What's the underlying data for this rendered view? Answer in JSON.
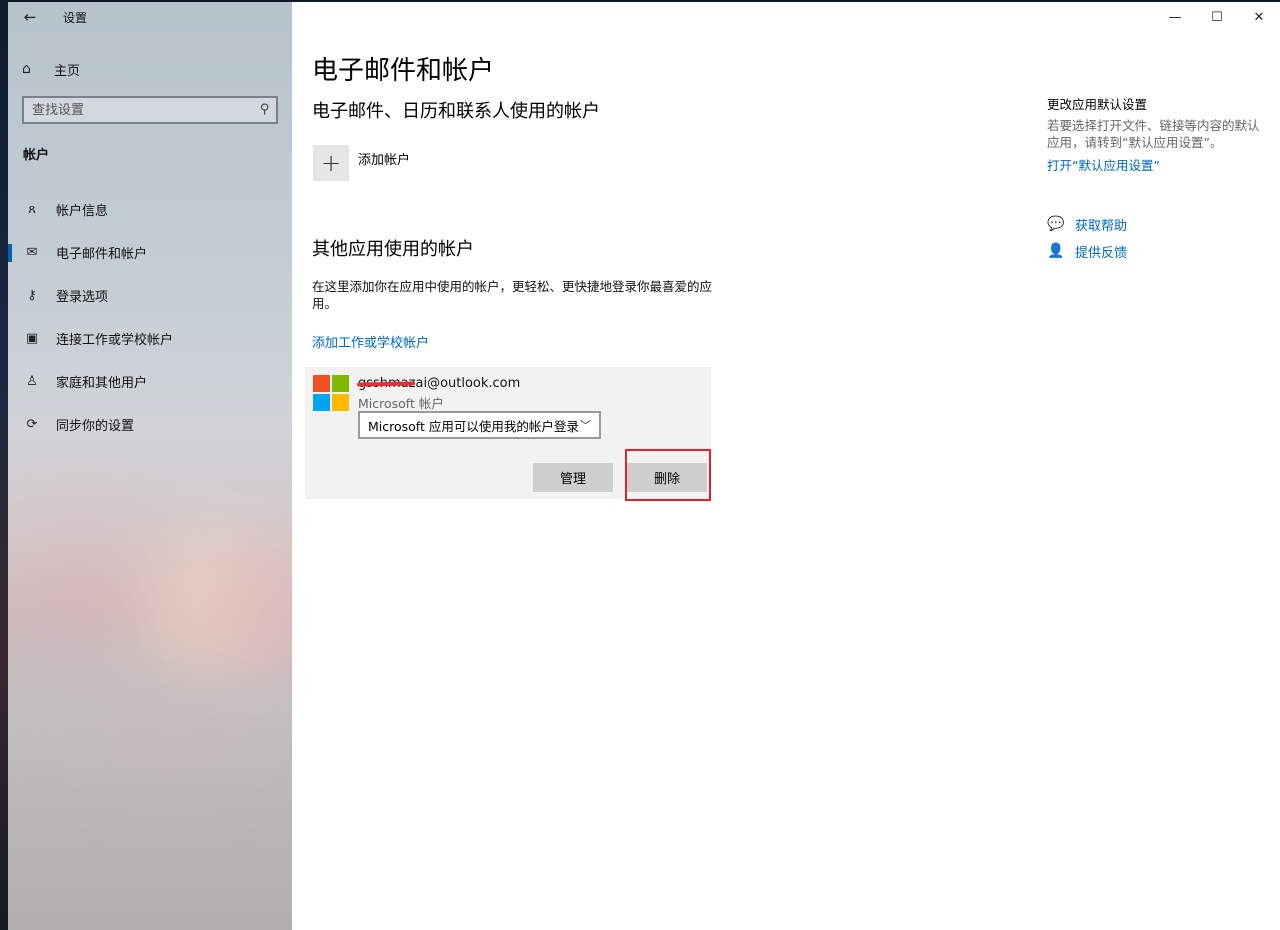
{
  "window": {
    "app_title": "设置",
    "controls": {
      "minimize": "—",
      "maximize": "☐",
      "close": "✕"
    }
  },
  "sidebar": {
    "home_label": "主页",
    "search_placeholder": "查找设置",
    "section_label": "帐户",
    "items": [
      {
        "label": "帐户信息",
        "icon": "person-list-icon",
        "active": false
      },
      {
        "label": "电子邮件和帐户",
        "icon": "mail-icon",
        "active": true
      },
      {
        "label": "登录选项",
        "icon": "key-icon",
        "active": false
      },
      {
        "label": "连接工作或学校帐户",
        "icon": "briefcase-icon",
        "active": false
      },
      {
        "label": "家庭和其他用户",
        "icon": "person-add-icon",
        "active": false
      },
      {
        "label": "同步你的设置",
        "icon": "sync-icon",
        "active": false
      }
    ]
  },
  "main": {
    "page_title": "电子邮件和帐户",
    "section1_title": "电子邮件、日历和联系人使用的帐户",
    "add_account_label": "添加帐户",
    "section2_title": "其他应用使用的帐户",
    "section2_desc": "在这里添加你在应用中使用的帐户，更轻松、更快捷地登录你最喜爱的应用。",
    "add_work_link": "添加工作或学校帐户",
    "account": {
      "email": "gsshmazai@outlook.com",
      "type": "Microsoft 帐户",
      "dropdown_value": "Microsoft 应用可以使用我的帐户登录",
      "manage_label": "管理",
      "delete_label": "删除"
    }
  },
  "right_panel": {
    "title": "更改应用默认设置",
    "desc": "若要选择打开文件、链接等内容的默认应用，请转到“默认应用设置”。",
    "link": "打开“默认应用设置”",
    "help_label": "获取帮助",
    "feedback_label": "提供反馈"
  },
  "colors": {
    "accent": "#0067c0",
    "highlight": "#e0222e",
    "ms_red": "#f25022",
    "ms_green": "#7fba00",
    "ms_blue": "#00a4ef",
    "ms_yellow": "#ffb900"
  }
}
